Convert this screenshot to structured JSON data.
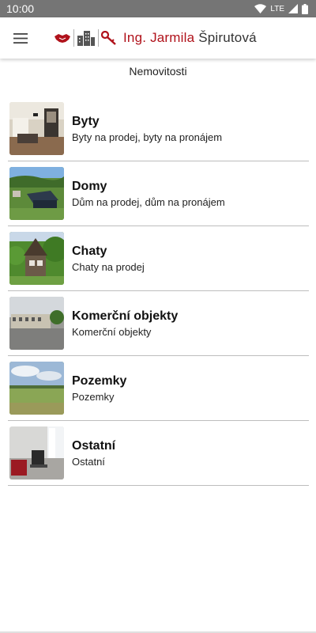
{
  "status_bar": {
    "time": "10:00",
    "network": "LTE"
  },
  "app_bar": {
    "brand_red": "Ing. Jarmila",
    "brand_dark": "Špirutová",
    "brand_color": "#b0121b"
  },
  "page": {
    "title": "Nemovitosti"
  },
  "categories": [
    {
      "title": "Byty",
      "subtitle": "Byty na prodej, byty na pronájem"
    },
    {
      "title": "Domy",
      "subtitle": "Dům na prodej, dům na pronájem"
    },
    {
      "title": "Chaty",
      "subtitle": "Chaty na prodej"
    },
    {
      "title": "Komerční objekty",
      "subtitle": "Komerční objekty"
    },
    {
      "title": "Pozemky",
      "subtitle": "Pozemky"
    },
    {
      "title": "Ostatní",
      "subtitle": "Ostatní"
    }
  ]
}
